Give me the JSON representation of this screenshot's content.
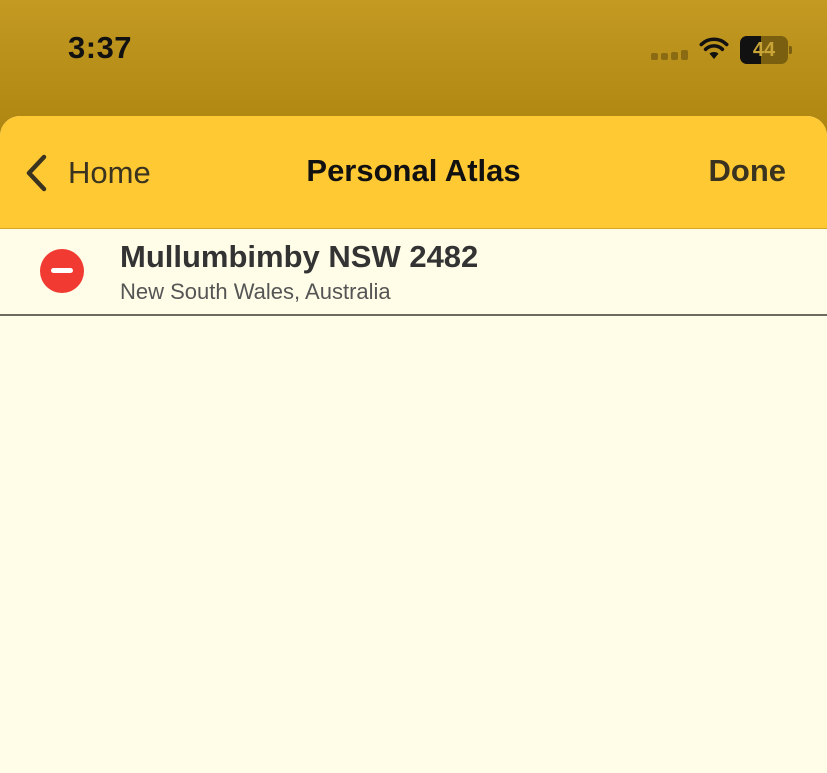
{
  "status_bar": {
    "time": "3:37",
    "battery_level": "44",
    "battery_fraction": 0.44,
    "icons": [
      "cellular-signal-icon",
      "wifi-icon",
      "battery-icon"
    ]
  },
  "nav": {
    "back_label": "Home",
    "title": "Personal Atlas",
    "done_label": "Done",
    "back_icon": "chevron-left-icon"
  },
  "list": {
    "items": [
      {
        "title": "Mullumbimby NSW 2482",
        "subtitle": "New South Wales, Australia",
        "delete_icon": "minus-circle-icon"
      }
    ]
  },
  "colors": {
    "status_bar_bg": "#B8901A",
    "nav_bar_bg": "#FFC933",
    "content_bg": "#FFFDE8",
    "delete_red": "#F03A32"
  }
}
